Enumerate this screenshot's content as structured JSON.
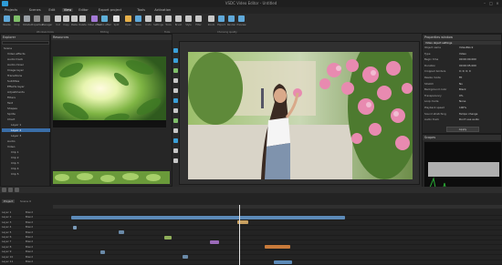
{
  "app": {
    "title": "VSDC Video Editor - Untitled",
    "window_controls": [
      "–",
      "□",
      "×"
    ]
  },
  "menu": {
    "items": [
      "Projects",
      "Scenes",
      "Edit",
      "View",
      "Editor",
      "Export project",
      "Tools",
      "Activation"
    ],
    "active_index": 3
  },
  "toolbar": {
    "buttons": [
      {
        "label": "Resize",
        "icon": "resize-icon",
        "color": "#5fa8d9"
      },
      {
        "label": "Crop",
        "icon": "crop-icon",
        "color": "#7fbf6a"
      },
      {
        "label": "Rotate",
        "icon": "rotate-icon",
        "color": "#9aa0a6"
      },
      {
        "label": "Properties",
        "icon": "properties-icon",
        "color": "#8c8c8c"
      },
      {
        "label": "Manager",
        "icon": "manager-icon",
        "color": "#8c8c8c"
      },
      {
        "label": "Cut",
        "icon": "cut-icon",
        "color": "#c8c8c8"
      },
      {
        "label": "Copy",
        "icon": "copy-icon",
        "color": "#c8c8c8"
      },
      {
        "label": "Paste",
        "icon": "paste-icon",
        "color": "#c8c8c8"
      },
      {
        "label": "Delete",
        "icon": "delete-icon",
        "color": "#c8c8c8"
      },
      {
        "label": "Video effects",
        "icon": "video-effects-icon",
        "color": "#a47ad6"
      },
      {
        "label": "Audio effects",
        "icon": "audio-effects-icon",
        "color": "#5fb0d9"
      },
      {
        "label": "Split",
        "icon": "split-icon",
        "color": "#e0e0e0"
      },
      {
        "label": "Open",
        "icon": "folder-icon",
        "color": "#e6b04a"
      },
      {
        "label": "Save",
        "icon": "save-icon",
        "color": "#5fa8d9"
      },
      {
        "label": "Undo",
        "icon": "undo-icon",
        "color": "#c8c8c8"
      },
      {
        "label": "Settings",
        "icon": "gear-icon",
        "color": "#c8c8c8"
      },
      {
        "label": "Tools",
        "icon": "tools-icon",
        "color": "#c8c8c8"
      },
      {
        "label": "Brush",
        "icon": "brush-icon",
        "color": "#c8c8c8"
      },
      {
        "label": "Style",
        "icon": "style-icon",
        "color": "#c8c8c8"
      },
      {
        "label": "Filter",
        "icon": "filter-icon",
        "color": "#c8c8c8"
      },
      {
        "label": "Zoom",
        "icon": "zoom-icon",
        "color": "#c8c8c8"
      },
      {
        "label": "Export",
        "icon": "export-icon",
        "color": "#5fa8d9"
      },
      {
        "label": "Render",
        "icon": "render-icon",
        "color": "#5fa8d9"
      },
      {
        "label": "Preview",
        "icon": "preview-icon",
        "color": "#5fa8d9"
      }
    ],
    "group_labels": [
      "Windows tools",
      "Editing",
      "Tools",
      "Choosing quality"
    ]
  },
  "explorer": {
    "title": "Explorer",
    "items": [
      {
        "label": "Scene",
        "depth": 0,
        "selected": false
      },
      {
        "label": "Video effects",
        "depth": 1,
        "selected": false
      },
      {
        "label": "Audio track",
        "depth": 1,
        "selected": false
      },
      {
        "label": "Audio mixer",
        "depth": 1,
        "selected": false
      },
      {
        "label": "Image layer",
        "depth": 1,
        "selected": false
      },
      {
        "label": "Transitions",
        "depth": 1,
        "selected": false
      },
      {
        "label": "Subtitles",
        "depth": 1,
        "selected": false
      },
      {
        "label": "Effects layer",
        "depth": 1,
        "selected": false
      },
      {
        "label": "Adjustments",
        "depth": 1,
        "selected": false
      },
      {
        "label": "Filters",
        "depth": 1,
        "selected": false
      },
      {
        "label": "Text",
        "depth": 1,
        "selected": false
      },
      {
        "label": "Shapes",
        "depth": 1,
        "selected": false
      },
      {
        "label": "Sprite",
        "depth": 1,
        "selected": false
      },
      {
        "label": "Chart",
        "depth": 1,
        "selected": false
      },
      {
        "label": "Layer 1",
        "depth": 2,
        "selected": false
      },
      {
        "label": "Layer 2",
        "depth": 2,
        "selected": true
      },
      {
        "label": "Layer 3",
        "depth": 2,
        "selected": false
      },
      {
        "label": "Audio",
        "depth": 1,
        "selected": false
      },
      {
        "label": "Video",
        "depth": 1,
        "selected": false
      },
      {
        "label": "Clip 1",
        "depth": 2,
        "selected": false
      },
      {
        "label": "Clip 2",
        "depth": 2,
        "selected": false
      },
      {
        "label": "Clip 3",
        "depth": 2,
        "selected": false
      },
      {
        "label": "Clip 4",
        "depth": 2,
        "selected": false
      },
      {
        "label": "Clip 5",
        "depth": 2,
        "selected": false
      }
    ]
  },
  "media_panel": {
    "title": "Resources"
  },
  "properties": {
    "title": "Properties window",
    "section": "Video object settings",
    "rows": [
      {
        "name": "Object name",
        "value": "VideoBlock"
      },
      {
        "name": "Type",
        "value": "Video"
      },
      {
        "name": "Begin time",
        "value": "00:00:00.000"
      },
      {
        "name": "Duration",
        "value": "00:00:05.000"
      },
      {
        "name": "Cropped borders",
        "value": "0; 0; 0; 0"
      },
      {
        "name": "Resize mode",
        "value": "Fit"
      },
      {
        "name": "Stretch",
        "value": "No"
      },
      {
        "name": "Background color",
        "value": "Black"
      },
      {
        "name": "Transparency",
        "value": "0%"
      },
      {
        "name": "Loop mode",
        "value": "None"
      },
      {
        "name": "Playback speed",
        "value": "100%"
      },
      {
        "name": "Sound stretching",
        "value": "Tempo change"
      },
      {
        "name": "Audio track",
        "value": "Don't use audio"
      }
    ],
    "apply_label": "Apply"
  },
  "scope": {
    "title": "Scopes"
  },
  "timeline": {
    "tabs": [
      "Project",
      "Scene 0"
    ],
    "tracks": [
      "Layer 1",
      "Layer 2",
      "Layer 3",
      "Layer 4",
      "Layer 5",
      "Layer 6",
      "Layer 7",
      "Layer 8",
      "Layer 9",
      "Layer 10",
      "Layer 11"
    ],
    "track_prefix": "Blend"
  }
}
